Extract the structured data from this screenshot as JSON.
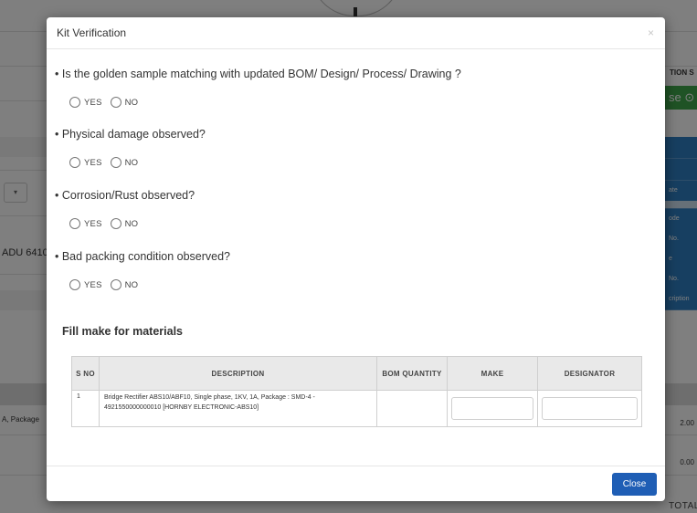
{
  "background": {
    "header_fragment": "TION S",
    "status_button": "se",
    "left_field": "ADU 6410",
    "left_row": "A, Package",
    "row_values": [
      "2.00",
      "0.00"
    ],
    "total_label": "TOTAL",
    "side_items": [
      "ate",
      "ode",
      "No.",
      "e",
      "No.",
      "cription"
    ]
  },
  "modal": {
    "title": "Kit Verification",
    "close_icon": "×",
    "option_yes": "YES",
    "option_no": "NO",
    "questions": [
      "• Is the golden sample matching with updated BOM/ Design/ Process/ Drawing ?",
      "• Physical damage observed?",
      "• Corrosion/Rust observed?",
      "• Bad packing condition observed?"
    ],
    "section_title": "Fill make for materials",
    "table": {
      "headers": {
        "sno": "S NO",
        "description": "DESCRIPTION",
        "bom_quantity": "BOM QUANTITY",
        "make": "MAKE",
        "designator": "DESIGNATOR"
      },
      "rows": [
        {
          "sno": "1",
          "description": "Bridge Rectifier ABS10/ABF10, Single phase, 1KV, 1A, Package : SMD-4 - 4921550000000010 [HORNBY ELECTRONIC-ABS10]",
          "bom_quantity": "",
          "make": "",
          "designator": ""
        }
      ]
    },
    "close_button": "Close"
  }
}
